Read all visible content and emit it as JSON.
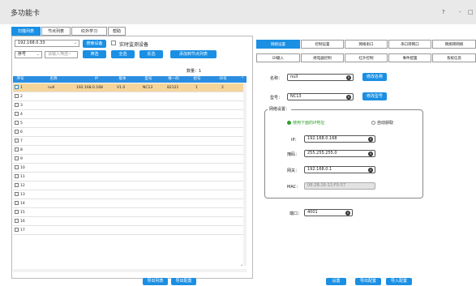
{
  "window": {
    "title": "多功能卡",
    "help_icon": "?",
    "minimize_icon": "-",
    "maximize_icon": "□"
  },
  "tabs": [
    "扫描列表",
    "节点列表",
    "红外学习",
    "帮助"
  ],
  "left": {
    "ip_select": "192.168.0.33",
    "search_btn": "搜索设备",
    "realtime_label": "实时监测设备",
    "sort_select": "序号",
    "filter_placeholder": "请输入筛选~",
    "filter_btn": "筛选",
    "select_all_btn": "全选",
    "invert_btn": "反选",
    "add_to_node_btn": "添加到节点列表",
    "count_label": "数量：1",
    "columns": [
      "序号",
      "名称",
      "IP",
      "版本",
      "型号",
      "唯一码",
      "组号",
      "ID号"
    ],
    "rows": [
      [
        "1",
        "null",
        "192.168.0.168",
        "V1.0",
        "NC13",
        "82121",
        "1",
        "2"
      ],
      [
        "2"
      ],
      [
        "3"
      ],
      [
        "4"
      ],
      [
        "5"
      ],
      [
        "6"
      ],
      [
        "7"
      ],
      [
        "8"
      ],
      [
        "9"
      ],
      [
        "10"
      ],
      [
        "11"
      ],
      [
        "12"
      ],
      [
        "13"
      ],
      [
        "14"
      ],
      [
        "15"
      ],
      [
        "16"
      ],
      [
        "17"
      ]
    ],
    "export_btn": "导出列表",
    "import_cfg_btn": "导出配置"
  },
  "right": {
    "tabs_row1": [
      "网络设置",
      "控制设置",
      "网络串口",
      "串口转网口",
      "网络转网络"
    ],
    "tabs_row2": [
      "DI输入",
      "继电器控制",
      "红外控制",
      "事件配置",
      "系统信息"
    ],
    "name_label": "名称：",
    "name_value": "null",
    "rename_btn": "修改名称",
    "model_label": "型号：",
    "model_value": "NC13",
    "remodel_btn": "修改型号",
    "net_group_title": "网络设置：",
    "radio_static": "使用下面的IP地址",
    "radio_dhcp": "自动获取",
    "ip_label": "IP：",
    "ip_value": "192.168.0.168",
    "mask_label": "掩码：",
    "mask_value": "255.255.255.0",
    "gw_label": "网关：",
    "gw_value": "192.168.0.1",
    "mac_label": "MAC：",
    "mac_value": "08-2B-26-12-F0-57",
    "port_label": "端口：",
    "port_value": "4001",
    "set_btn": "设置",
    "export_cfg_btn": "导出配置",
    "import_cfg_btn": "导入配置"
  },
  "colors": {
    "accent": "#1a8fe3",
    "selected_row": "#f6d59b",
    "radio_on": "#2ca02c"
  }
}
